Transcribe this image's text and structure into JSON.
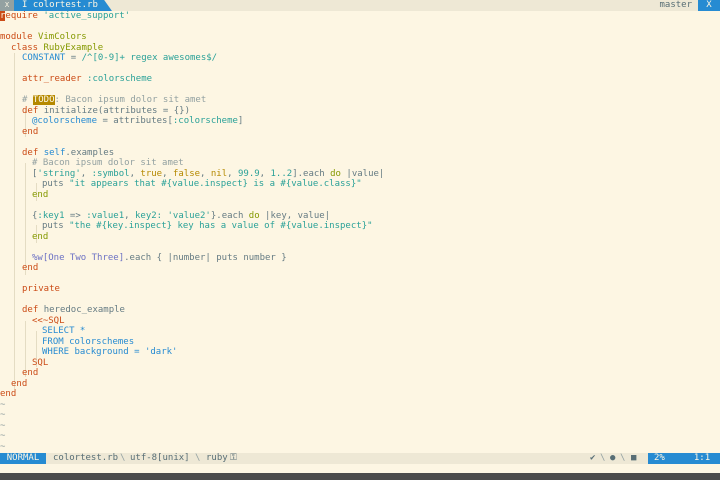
{
  "tabline": {
    "close_x": "X",
    "tab_label": "I colortest.rb",
    "branch": "master",
    "close_button": "X"
  },
  "code": {
    "l1_cursor": "r",
    "l1_a": "equire ",
    "l1_b": "'active_support'",
    "l3_a": "module ",
    "l3_b": "VimColors",
    "l4_a": "class ",
    "l4_b": "RubyExample",
    "l5_a": "CONSTANT",
    "l5_b": " = ",
    "l5_c": "/^[0-9]+ regex awesomes$/",
    "l7_a": "attr_reader ",
    "l7_b": ":colorscheme",
    "l9_a": "# ",
    "l9_todo": "TODO",
    "l9_b": ": Bacon ipsum dolor sit amet",
    "l10_a": "def ",
    "l10_b": "initialize(attributes = {})",
    "l11_a": "@colorscheme",
    "l11_b": " = attributes[",
    "l11_c": ":colorscheme",
    "l11_d": "]",
    "l12": "end",
    "l14_a": "def ",
    "l14_b": "self",
    "l14_c": ".examples",
    "l15": "# Bacon ipsum dolor sit amet",
    "l16_a": "[",
    "l16_b": "'string'",
    "l16_c": ", ",
    "l16_d": ":symbol",
    "l16_e": ", ",
    "l16_f": "true",
    "l16_g": ", ",
    "l16_h": "false",
    "l16_i": ", ",
    "l16_j": "nil",
    "l16_k": ", ",
    "l16_l": "99.9",
    "l16_m": ", ",
    "l16_n": "1..2",
    "l16_o": "].each ",
    "l16_p": "do",
    "l16_q": " |value|",
    "l17_a": "puts ",
    "l17_b": "\"it appears that #{value.inspect} is a #{value.class}\"",
    "l18": "end",
    "l20_a": "{",
    "l20_b": ":key1",
    "l20_c": " => ",
    "l20_d": ":value1",
    "l20_e": ", ",
    "l20_f": "key2:",
    "l20_g": " ",
    "l20_h": "'value2'",
    "l20_i": "}.each ",
    "l20_j": "do",
    "l20_k": " |key, value|",
    "l21_a": "puts ",
    "l21_b": "\"the #{key.inspect} key has a value of #{value.inspect}\"",
    "l22": "end",
    "l24_a": "%w[One Two Three]",
    "l24_b": ".each { |number| puts number }",
    "l25": "end",
    "l27": "private",
    "l29_a": "def ",
    "l29_b": "heredoc_example",
    "l30": "<<~SQL",
    "l31": "SELECT *",
    "l32": "FROM colorschemes",
    "l33": "WHERE background = 'dark'",
    "l34": "SQL",
    "l35": "end",
    "l36": "end",
    "l37": "end",
    "tilde": "~"
  },
  "statusline": {
    "mode": "NORMAL",
    "filename": "colortest.rb",
    "encoding": "utf-8[unix]",
    "filetype": "ruby",
    "percent": "2%",
    "position": "1:1",
    "check_glyph": "✔",
    "dot_glyph": "●",
    "square_glyph": "■",
    "lock_glyph": "⚿",
    "sep": "\\"
  },
  "colors": {
    "background": "#fdf6e3",
    "accent": "#268bd2",
    "keyword": "#cb4b16",
    "string": "#2aa198",
    "boolean": "#b58900",
    "comment": "#93a1a1",
    "heredoc": "#268bd2"
  }
}
